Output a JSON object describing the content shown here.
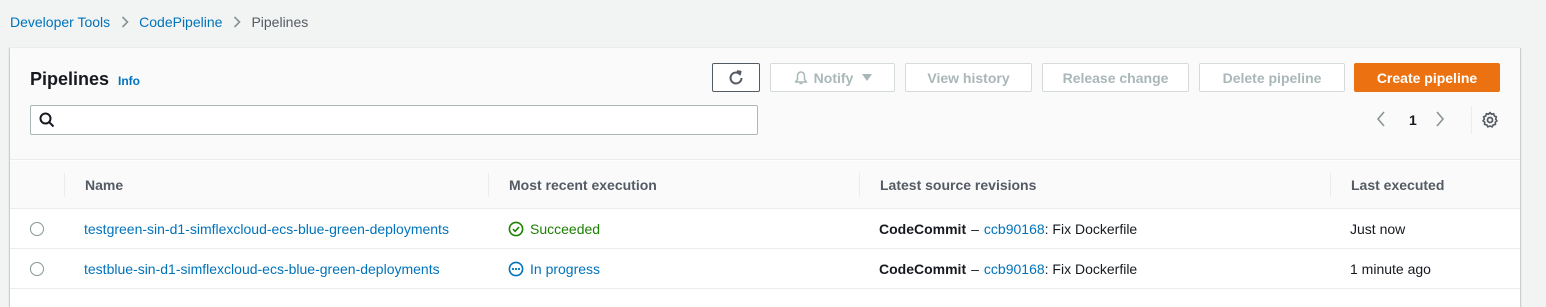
{
  "breadcrumb": {
    "items": [
      "Developer Tools",
      "CodePipeline"
    ],
    "current": "Pipelines"
  },
  "header": {
    "title": "Pipelines",
    "info": "Info"
  },
  "toolbar": {
    "notify": "Notify",
    "view_history": "View history",
    "release_change": "Release change",
    "delete_pipeline": "Delete pipeline",
    "create_pipeline": "Create pipeline"
  },
  "search": {
    "placeholder": "",
    "value": ""
  },
  "pagination": {
    "current_page": "1"
  },
  "table": {
    "columns": [
      "Name",
      "Most recent execution",
      "Latest source revisions",
      "Last executed"
    ],
    "rows": [
      {
        "name": "testgreen-sin-d1-simflexcloud-ecs-blue-green-deployments",
        "status": "Succeeded",
        "status_icon": "check-circle-icon",
        "source_provider": "CodeCommit",
        "dash": "–",
        "commit_id": "ccb90168",
        "commit_msg": ": Fix Dockerfile",
        "last_executed": "Just now"
      },
      {
        "name": "testblue-sin-d1-simflexcloud-ecs-blue-green-deployments",
        "status": "In progress",
        "status_icon": "in-progress-icon",
        "source_provider": "CodeCommit",
        "dash": "–",
        "commit_id": "ccb90168",
        "commit_msg": ": Fix Dockerfile",
        "last_executed": "1 minute ago"
      }
    ]
  },
  "colors": {
    "link": "#0073bb",
    "primary": "#ec7211",
    "success": "#1d8102"
  }
}
